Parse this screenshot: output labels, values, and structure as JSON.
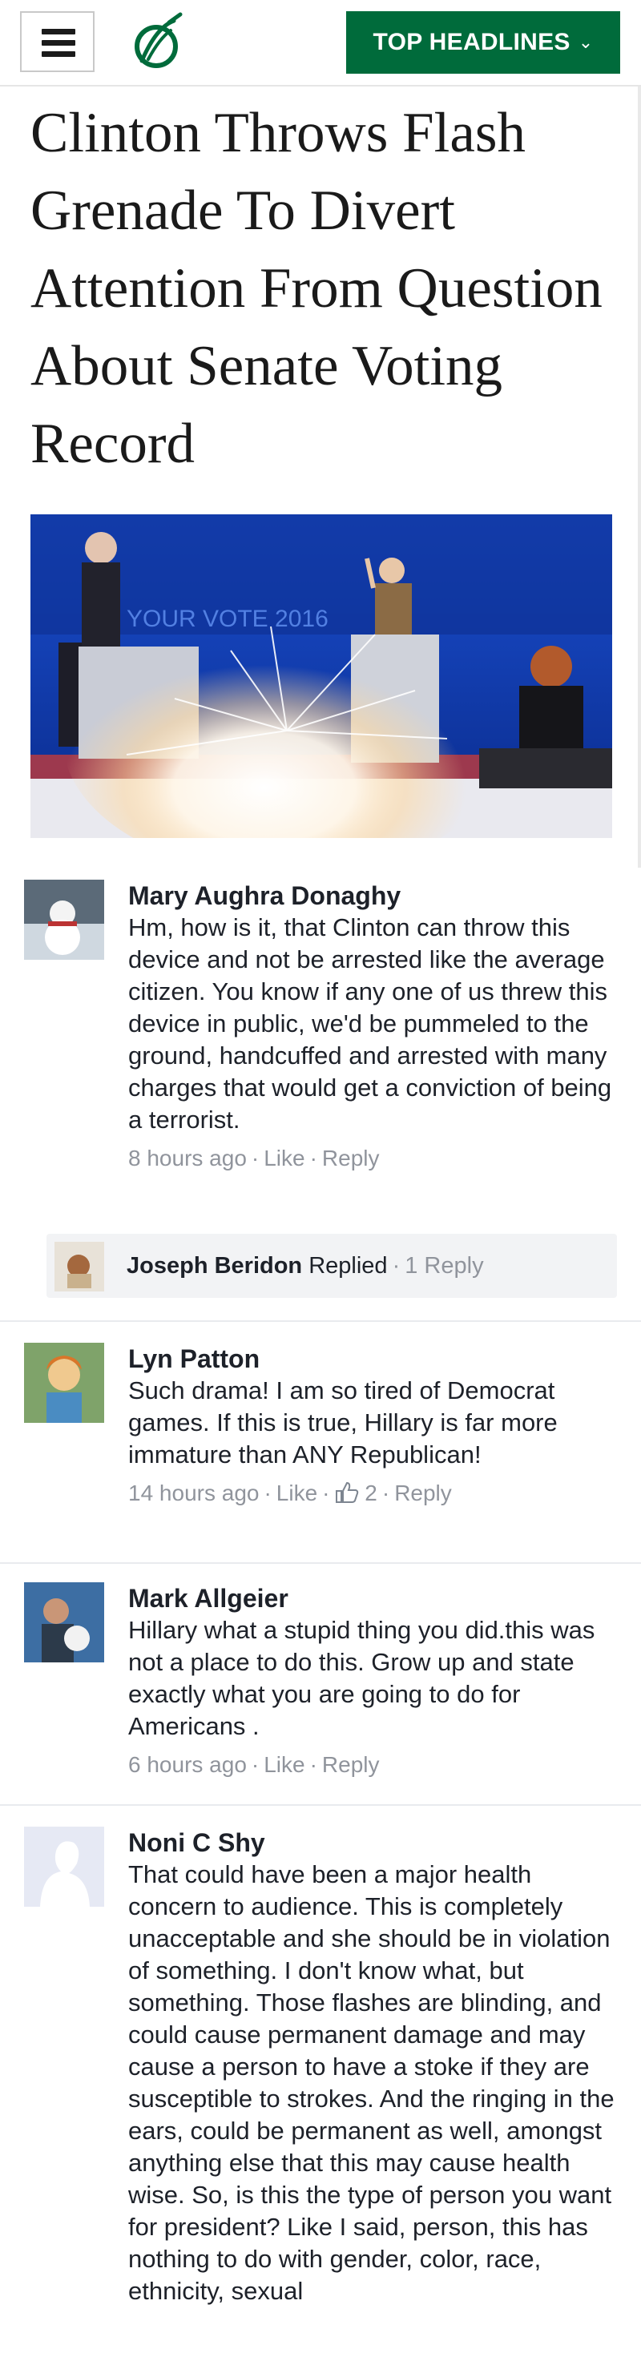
{
  "header": {
    "menu_icon": "hamburger-menu-icon",
    "logo_icon": "onion-logo-icon",
    "headlines_label": "TOP HEADLINES",
    "headlines_chevron": "⌄",
    "brand_color": "#006b3b"
  },
  "article": {
    "title": "Clinton Throws Flash Grenade To Divert Attention From Question About Senate Voting Record",
    "image_backdrop_text": "YOUR VOTE 2016"
  },
  "comments": [
    {
      "name": "Mary Aughra Donaghy",
      "text": "Hm, how is it, that Clinton can throw this device and not be arrested like the average citizen.  You know if any one of us threw this device in public, we'd be pummeled to the ground, handcuffed and arrested with many charges that would get a conviction of being a terrorist.",
      "time": "8 hours ago",
      "like": "Like",
      "reply": "Reply"
    },
    {
      "name": "Lyn Patton",
      "text": "Such drama! I am so tired of Democrat games. If this is true, Hillary is far more immature than ANY Republican!",
      "time": "14 hours ago",
      "like": "Like",
      "like_count": "2",
      "reply": "Reply"
    },
    {
      "name": "Mark Allgeier",
      "text": "Hillary what a stupid thing you did.this was not a place to do this. Grow up and state exactly what you are going to do for Americans .",
      "time": "6 hours ago",
      "like": "Like",
      "reply": "Reply"
    },
    {
      "name": "Noni C Shy",
      "text": "That could have been a major health concern to audience.  This is completely unacceptable and she should be in violation of something. I don't know what, but something. Those flashes are blinding, and could cause permanent damage and may cause a person to have a stoke if they are susceptible to strokes. And the ringing in the ears, could be permanent as well, amongst anything else that this may cause health wise. So, is this the type of person you want for president? Like I said, person,  this has nothing to do with gender, color, race, ethnicity, sexual"
    }
  ],
  "reply_thread": {
    "name": "Joseph Beridon",
    "action": "Replied",
    "count": "1 Reply"
  }
}
